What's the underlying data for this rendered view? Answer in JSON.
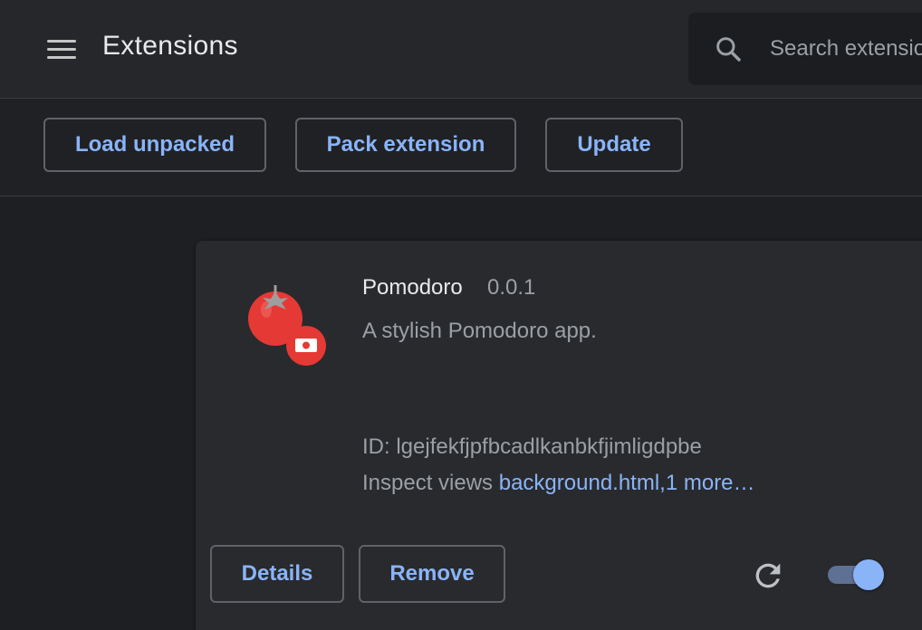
{
  "header": {
    "title": "Extensions",
    "search_placeholder": "Search extensions"
  },
  "toolbar": {
    "load_unpacked_label": "Load unpacked",
    "pack_extension_label": "Pack extension",
    "update_label": "Update"
  },
  "extension": {
    "name": "Pomodoro",
    "version": "0.0.1",
    "description": "A stylish Pomodoro app.",
    "id_text": "ID: lgejfekfjpfbcadlkanbkfjimligdpbe",
    "inspect_label": "Inspect views",
    "inspect_link": "background.html,1 more…",
    "details_label": "Details",
    "remove_label": "Remove",
    "enabled": true
  },
  "colors": {
    "accent": "#8ab4f8",
    "background": "#202124",
    "card": "#292a2d",
    "icon_red": "#e53935"
  },
  "icons": [
    "menu-icon",
    "search-icon",
    "tomato-icon",
    "reload-icon"
  ]
}
